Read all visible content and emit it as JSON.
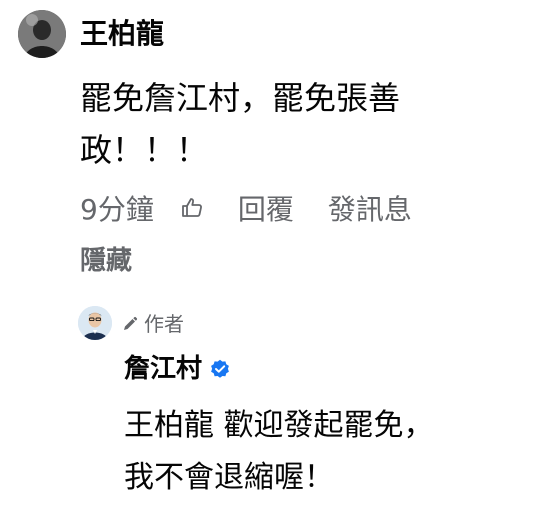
{
  "comment": {
    "author": "王柏龍",
    "text_lines": [
      "罷免詹江村，罷免張善",
      "政！！！"
    ],
    "time": "9分鐘",
    "reply_label": "回覆",
    "message_label": "發訊息",
    "hide_label": "隱藏"
  },
  "reply": {
    "author_badge": "作者",
    "author": "詹江村",
    "text_lines": [
      "王柏龍 歡迎發起罷免，",
      "我不會退縮喔！"
    ]
  },
  "colors": {
    "text": "#050505",
    "secondary": "#65676b",
    "verified": "#1877f2"
  },
  "icons": {
    "like": "thumbs-up-outline-icon",
    "pencil": "pencil-icon",
    "verified": "verified-badge-icon"
  }
}
